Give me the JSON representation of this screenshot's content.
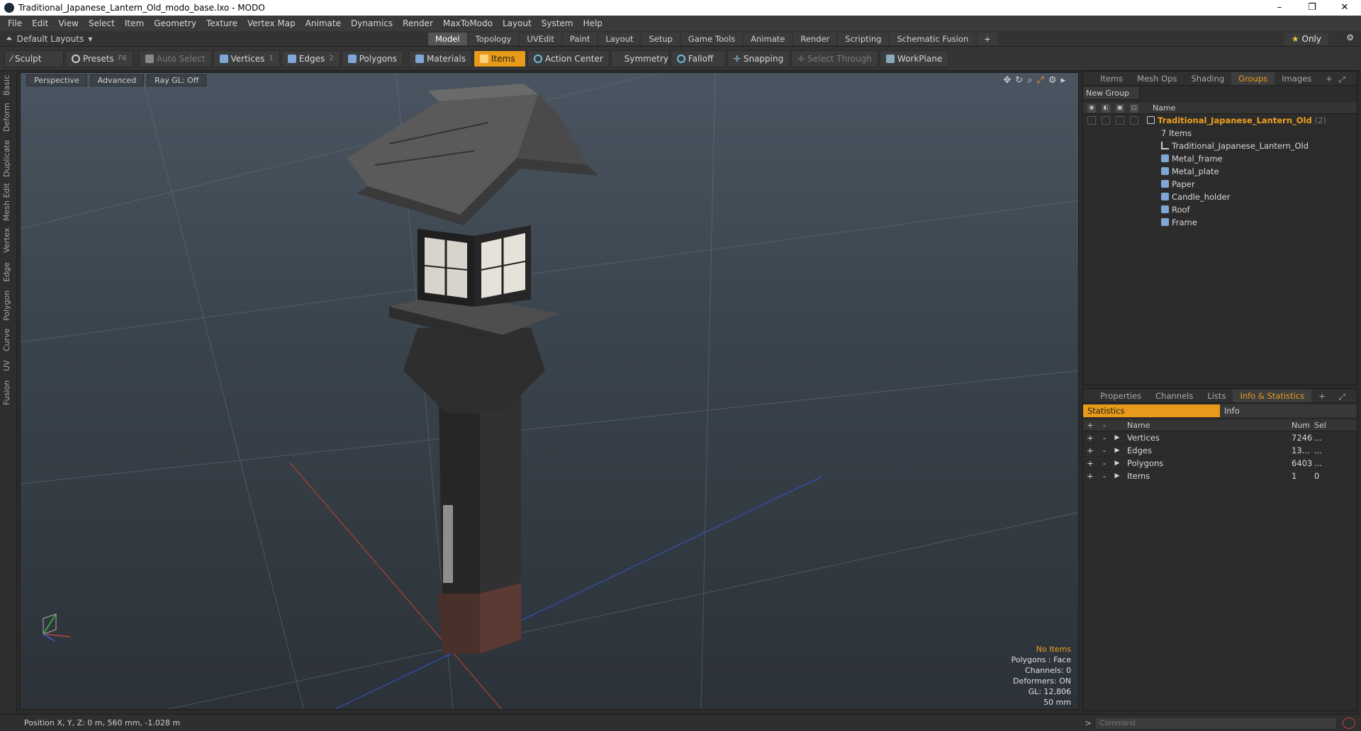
{
  "window": {
    "title": "Traditional_Japanese_Lantern_Old_modo_base.lxo - MODO"
  },
  "menu": [
    "File",
    "Edit",
    "View",
    "Select",
    "Item",
    "Geometry",
    "Texture",
    "Vertex Map",
    "Animate",
    "Dynamics",
    "Render",
    "MaxToModo",
    "Layout",
    "System",
    "Help"
  ],
  "layout": {
    "selector": "Default Layouts",
    "tabs": [
      "Model",
      "Topology",
      "UVEdit",
      "Paint",
      "Layout",
      "Setup",
      "Game Tools",
      "Animate",
      "Render",
      "Scripting",
      "Schematic Fusion"
    ],
    "active_tab": "Model",
    "only": "Only"
  },
  "toolbar": {
    "sculpt": "Sculpt",
    "presets": "Presets",
    "presets_key": "F6",
    "auto_select": "Auto Select",
    "vertices": "Vertices",
    "vertices_n": "1",
    "edges": "Edges",
    "edges_n": "2",
    "polygons": "Polygons",
    "materials": "Materials",
    "items": "Items",
    "action_center": "Action Center",
    "symmetry": "Symmetry",
    "falloff": "Falloff",
    "snapping": "Snapping",
    "select_through": "Select Through",
    "workplane": "WorkPlane"
  },
  "left_tabs": [
    "Basic",
    "Deform",
    "Duplicate",
    "Mesh Edit",
    "Vertex",
    "Edge",
    "Polygon",
    "Curve",
    "UV",
    "Fusion"
  ],
  "viewport": {
    "view": "Perspective",
    "advanced": "Advanced",
    "raygl": "Ray GL: Off",
    "info": {
      "no_items": "No Items",
      "polygons": "Polygons : Face",
      "channels": "Channels: 0",
      "deformers": "Deformers: ON",
      "gl": "GL: 12,806",
      "size": "50 mm"
    }
  },
  "status": {
    "position": "Position X, Y, Z:   0 m, 560 mm, -1.028 m",
    "command_placeholder": "Command"
  },
  "groups_panel": {
    "tabs": [
      "Items",
      "Mesh Ops",
      "Shading",
      "Groups",
      "Images"
    ],
    "active": "Groups",
    "new_group": "New Group",
    "name_col": "Name",
    "group_name": "Traditional_Japanese_Lantern_Old",
    "group_count": "(2)",
    "items_count": "7 Items",
    "children": [
      "Traditional_Japanese_Lantern_Old",
      "Metal_frame",
      "Metal_plate",
      "Paper",
      "Candle_holder",
      "Roof",
      "Frame"
    ]
  },
  "stats_panel": {
    "tabs": [
      "Properties",
      "Channels",
      "Lists",
      "Info & Statistics"
    ],
    "active": "Info & Statistics",
    "sub_tabs": [
      "Statistics",
      "Info"
    ],
    "cols": {
      "name": "Name",
      "num": "Num",
      "sel": "Sel"
    },
    "rows": [
      {
        "name": "Vertices",
        "num": "7246",
        "sel": "..."
      },
      {
        "name": "Edges",
        "num": "13...",
        "sel": "..."
      },
      {
        "name": "Polygons",
        "num": "6403",
        "sel": "..."
      },
      {
        "name": "Items",
        "num": "1",
        "sel": "0"
      }
    ]
  },
  "colors": {
    "accent": "#e89a1b",
    "panel": "#2c2c2c"
  }
}
